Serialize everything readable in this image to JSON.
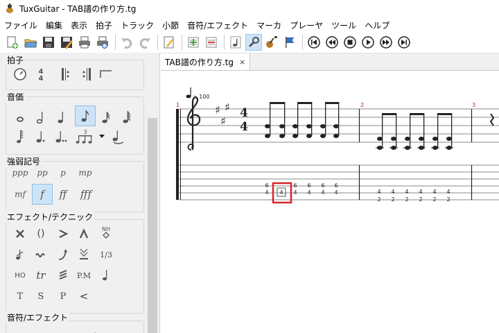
{
  "window": {
    "title": "TuxGuitar - TAB譜の作り方.tg"
  },
  "menu": [
    "ファイル",
    "編集",
    "表示",
    "拍子",
    "トラック",
    "小節",
    "音符/エフェクト",
    "マーカ",
    "プレーヤ",
    "ツール",
    "ヘルプ"
  ],
  "toolbar": {
    "icons": [
      "new-file-icon",
      "open-file-icon",
      "save-icon",
      "save-as-icon",
      "print-icon",
      "print-preview-icon",
      "undo-icon",
      "redo-icon",
      "edit-icon",
      "add-track-icon",
      "remove-track-icon",
      "note-icon",
      "settings-wrench-icon",
      "guitar-icon",
      "flag-icon",
      "first-icon",
      "previous-icon",
      "stop-icon",
      "play-icon",
      "next-icon",
      "last-icon"
    ]
  },
  "panel": {
    "time_title": "拍子",
    "duration_title": "音価",
    "dynamics_title": "強弱記号",
    "dynamics": [
      "ppp",
      "pp",
      "p",
      "mp",
      "mf",
      "f",
      "ff",
      "fff"
    ],
    "effects_title": "エフェクト/テクニック",
    "effects_text": [
      "()",
      "1/3",
      "HO",
      "tr",
      "P.M",
      "T",
      "S",
      "P",
      "<"
    ],
    "effects_nh": "NH",
    "note_effect_title": "音符/エフェクト",
    "tuplet_label": "3"
  },
  "tab": {
    "label": "TAB譜の作り方.tg",
    "close": "⨯"
  },
  "score": {
    "tempo": "= 100",
    "time_signature": [
      "4",
      "4"
    ],
    "measures": [
      {
        "number": "1",
        "tab": [
          [
            "6",
            "4"
          ],
          [
            "4",
            ""
          ],
          [
            "6",
            "4"
          ],
          [
            "6",
            "4"
          ],
          [
            "6",
            "4"
          ],
          [
            "6",
            "4"
          ]
        ]
      },
      {
        "number": "2",
        "tab": [
          [
            "4",
            "2"
          ],
          [
            "4",
            "2"
          ],
          [
            "4",
            "2"
          ],
          [
            "4",
            "2"
          ],
          [
            "4",
            "2"
          ],
          [
            "4",
            "2"
          ]
        ]
      },
      {
        "number": "3"
      }
    ],
    "highlight_color": "#d9232a"
  }
}
